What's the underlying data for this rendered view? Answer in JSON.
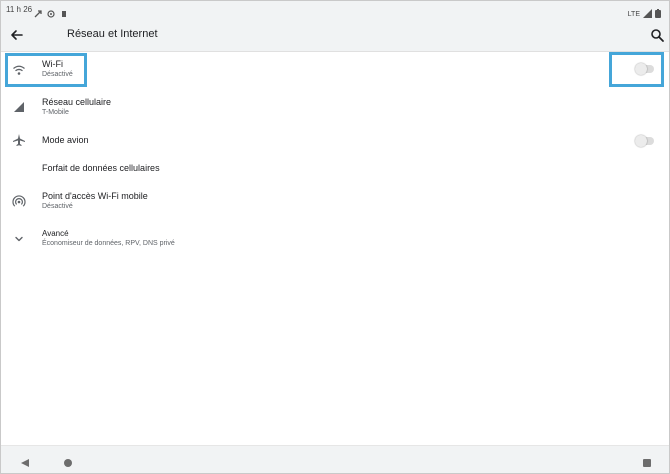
{
  "status_bar": {
    "time": "11 h 26",
    "network": "LTE"
  },
  "toolbar": {
    "title": "Réseau et Internet",
    "back_icon": "arrow-back-icon",
    "search_icon": "search-icon"
  },
  "settings": {
    "wifi": {
      "title": "Wi-Fi",
      "subtitle": "Désactivé",
      "icon": "wifi-icon",
      "toggle_on": false
    },
    "cellular": {
      "title": "Réseau cellulaire",
      "subtitle": "T-Mobile",
      "icon": "cell-signal-icon"
    },
    "airplane": {
      "title": "Mode avion",
      "icon": "airplane-icon",
      "toggle_on": false
    },
    "data_plan": {
      "title": "Forfait de données cellulaires"
    },
    "hotspot": {
      "title": "Point d'accès Wi-Fi mobile",
      "subtitle": "Désactivé",
      "icon": "hotspot-icon"
    },
    "advanced": {
      "title": "Avancé",
      "subtitle": "Économiseur de données, RPV, DNS privé",
      "icon": "chevron-down-icon"
    }
  },
  "colors": {
    "highlight": "#45a6d9",
    "bar_bg": "#f1f3f4",
    "icon": "#5f6368"
  }
}
